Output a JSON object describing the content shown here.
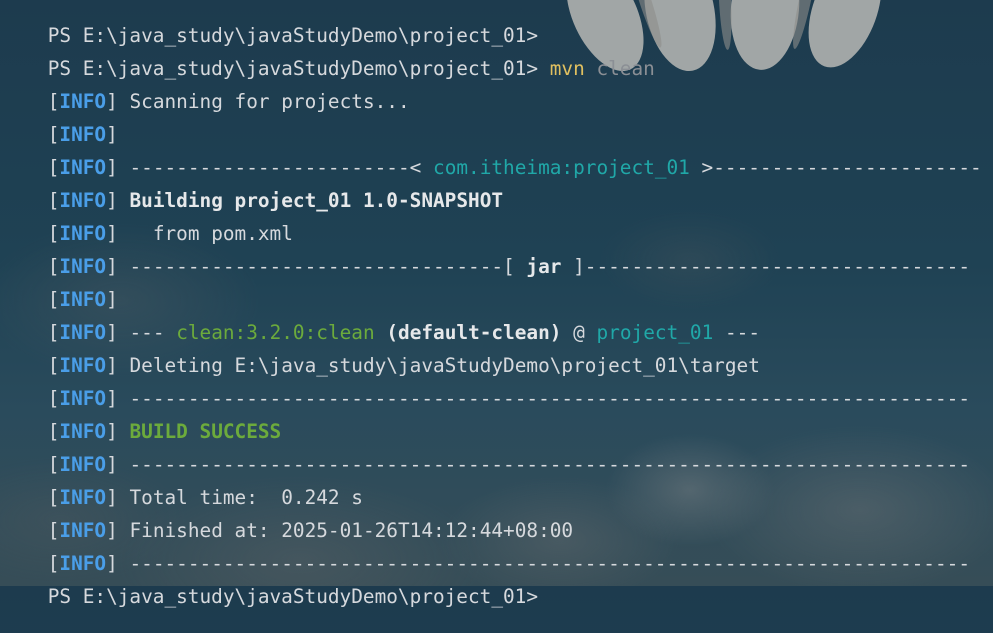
{
  "terminal": {
    "prompt_line_1": "PS E:\\java_study\\javaStudyDemo\\project_01>",
    "prompt_line_2": "PS E:\\java_study\\javaStudyDemo\\project_01>",
    "command_mvn": "mvn",
    "command_arg": "clean",
    "info_tag": "INFO",
    "scanning": "Scanning for projects...",
    "dash_left": "------------------------<",
    "artifact": "com.itheima:project_01",
    "dash_right": ">-----------------------",
    "building": "Building project_01 1.0-SNAPSHOT",
    "from_pom": "  from pom.xml",
    "jar_left": "--------------------------------[",
    "jar": " jar ",
    "jar_right": "]---------------------------------",
    "plugin_dashes_left": "---",
    "plugin_goal": "clean:3.2.0:clean",
    "plugin_exec": "(default-clean)",
    "at_sign": "@",
    "plugin_project": "project_01",
    "plugin_dashes_right": "---",
    "deleting": "Deleting E:\\java_study\\javaStudyDemo\\project_01\\target",
    "long_dashes": "------------------------------------------------------------------------",
    "build_success": "BUILD SUCCESS",
    "total_time": "Total time:  0.242 s",
    "finished_at": "Finished at: 2025-01-26T14:12:44+08:00",
    "prompt_line_3": "PS E:\\java_study\\javaStudyDemo\\project_01>"
  },
  "colors": {
    "info_tag": "#4a9ee8",
    "artifact": "#20a8a8",
    "plugin_goal": "#6cab3c",
    "success": "#6cab3c",
    "mvn": "#e0c060",
    "clean_arg": "#8b8f95"
  },
  "background": {
    "icon": "daisy-flower-icon"
  }
}
